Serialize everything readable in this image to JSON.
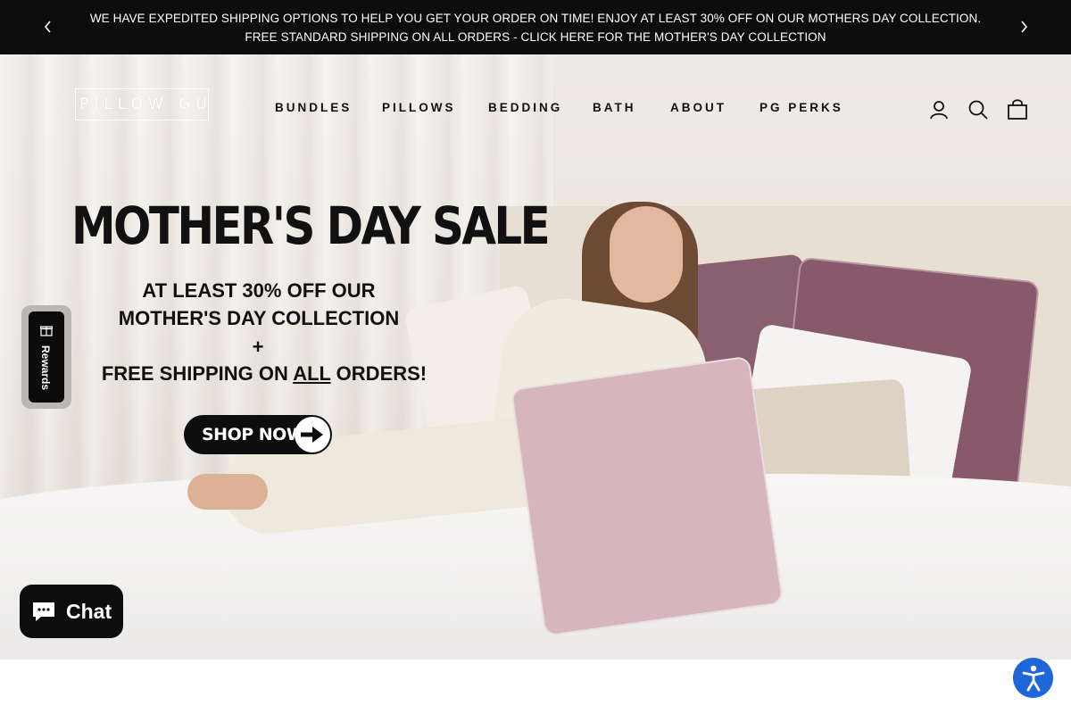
{
  "announcement": {
    "line1": "WE HAVE EXPEDITED SHIPPING OPTIONS TO HELP YOU GET YOUR ORDER ON TIME! ENJOY AT LEAST 30% OFF ON OUR MOTHERS DAY COLLECTION.",
    "line2": "FREE STANDARD SHIPPING ON ALL ORDERS - CLICK HERE FOR THE MOTHER'S DAY COLLECTION",
    "prev_icon": "chevron-left-icon",
    "next_icon": "chevron-right-icon"
  },
  "header": {
    "logo_text": "PILLOW GUY",
    "nav": [
      "BUNDLES",
      "PILLOWS",
      "BEDDING",
      "BATH",
      "ABOUT",
      "PG PERKS"
    ],
    "icons": [
      "account-icon",
      "search-icon",
      "cart-icon"
    ]
  },
  "hero": {
    "headline": "MOTHER'S DAY SALE",
    "sub_line1": "AT LEAST 30% OFF OUR",
    "sub_line2": "MOTHER'S DAY COLLECTION",
    "sub_plus": "+",
    "sub_line3_pre": "FREE SHIPPING ON ",
    "sub_line3_underlined": "ALL",
    "sub_line3_post": " ORDERS!",
    "cta_label": "SHOP NOW"
  },
  "widgets": {
    "rewards_label": "Rewards",
    "chat_label": "Chat"
  },
  "colors": {
    "announcement_bg": "#0d0d0d",
    "accessibility_blue": "#1f66d8",
    "chat_bg": "#0d0d0d"
  }
}
